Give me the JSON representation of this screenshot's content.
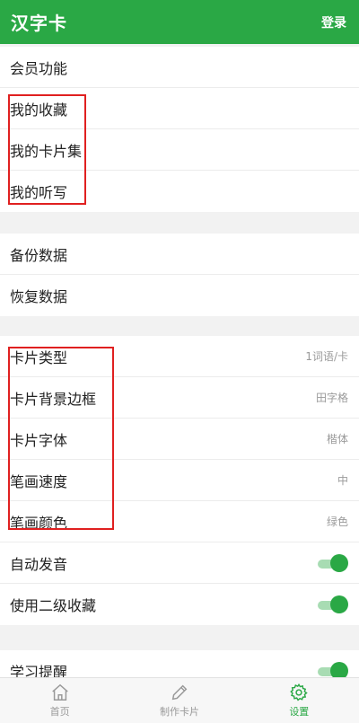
{
  "header": {
    "title": "汉字卡",
    "login_label": "登录"
  },
  "group1": [
    {
      "label": "会员功能"
    },
    {
      "label": "我的收藏"
    },
    {
      "label": "我的卡片集"
    },
    {
      "label": "我的听写"
    }
  ],
  "group2": [
    {
      "label": "备份数据"
    },
    {
      "label": "恢复数据"
    }
  ],
  "group3": [
    {
      "label": "卡片类型",
      "value": "1词语/卡"
    },
    {
      "label": "卡片背景边框",
      "value": "田字格"
    },
    {
      "label": "卡片字体",
      "value": "楷体"
    },
    {
      "label": "笔画速度",
      "value": "中"
    },
    {
      "label": "笔画颜色",
      "value": "绿色"
    },
    {
      "label": "自动发音",
      "on": true
    },
    {
      "label": "使用二级收藏",
      "on": true
    }
  ],
  "group4": [
    {
      "label": "学习提醒",
      "on": true
    }
  ],
  "tabbar": [
    {
      "label": "首页",
      "icon": "home-icon",
      "active": false
    },
    {
      "label": "制作卡片",
      "icon": "pencil-icon",
      "active": false
    },
    {
      "label": "设置",
      "icon": "gear-icon",
      "active": true
    }
  ],
  "colors": {
    "accent": "#2aa845",
    "highlight_box": "#e02020",
    "toggle_track": "#a8dcb3"
  }
}
